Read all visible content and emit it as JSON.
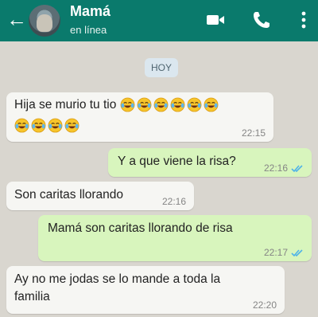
{
  "header": {
    "back_icon": "back-arrow-icon",
    "name": "Mamá",
    "status": "en línea",
    "icons": [
      "video-icon",
      "phone-icon",
      "more-vert-icon"
    ],
    "bar_color": "#0a7a6c"
  },
  "chat": {
    "date_chip": "HOY",
    "messages": [
      {
        "direction": "in",
        "text": "Hija se murio tu tio",
        "emoji": "face-with-tears-of-joy-icon",
        "emoji_count": 10,
        "time": "22:15"
      },
      {
        "direction": "out",
        "text": "Y a que viene la risa?",
        "time": "22:16",
        "status": "read"
      },
      {
        "direction": "in",
        "text": "Son caritas llorando",
        "time": "22:16"
      },
      {
        "direction": "out",
        "text": "Mamá son caritas llorando de risa",
        "time": "22:17",
        "status": "read"
      },
      {
        "direction": "in",
        "text_line1": "Ay no me jodas se lo mande a toda la",
        "text_line2": "familia",
        "time": "22:20"
      }
    ]
  },
  "colors": {
    "incoming_bubble": "#f6f6f3",
    "outgoing_bubble": "#d8f5bd",
    "read_tick": "#4fb3e8",
    "chat_background": "#d9d6cf"
  }
}
